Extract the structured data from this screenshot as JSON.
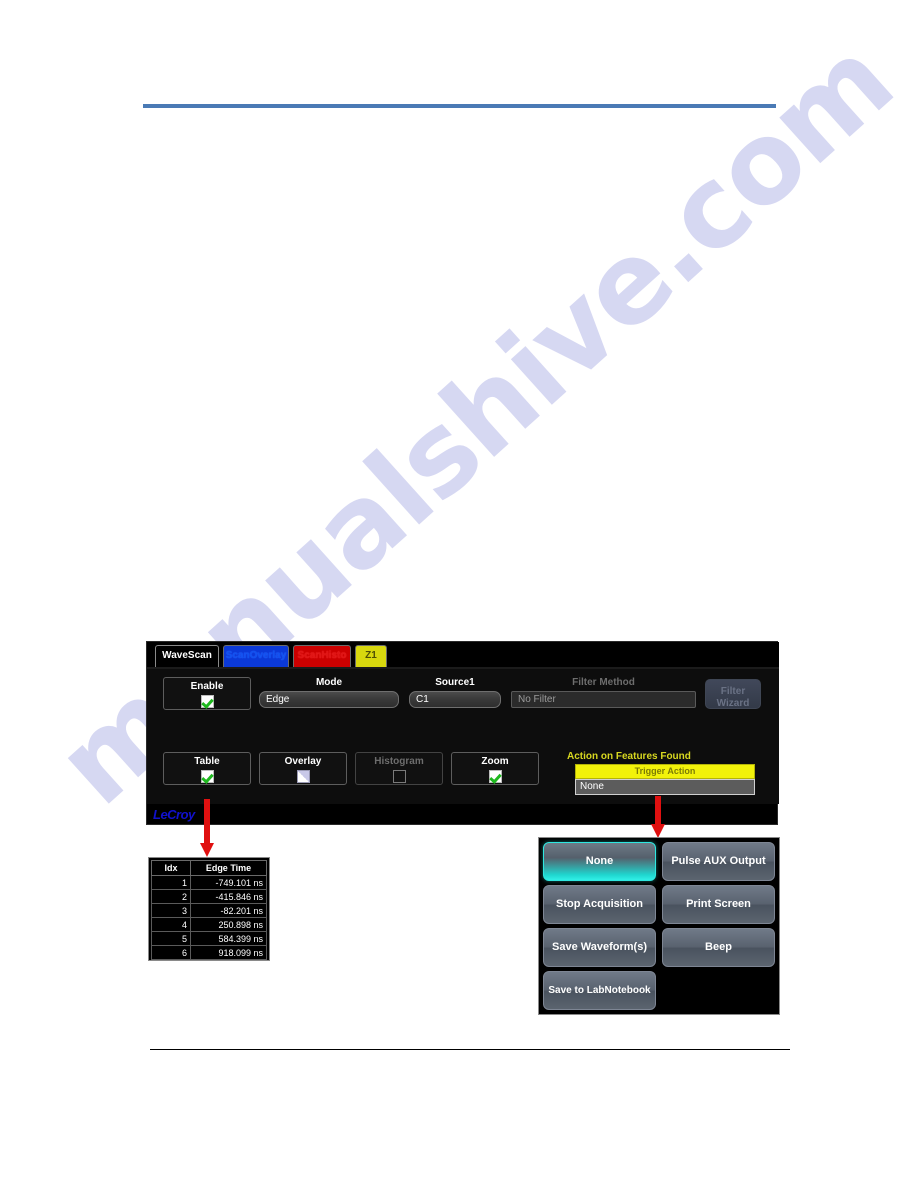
{
  "document": {
    "watermark_text": "manualshive.com"
  },
  "wavescan": {
    "tabs": [
      {
        "label": "WaveScan",
        "color": "#000000",
        "active": true
      },
      {
        "label": "ScanOverlay",
        "color": "#0b39d8",
        "active": false
      },
      {
        "label": "ScanHisto",
        "color": "#cc0000",
        "active": false
      },
      {
        "label": "Z1",
        "color": "#d8d80e",
        "active": false
      }
    ],
    "top_row": {
      "enable": {
        "label": "Enable",
        "checked": true
      },
      "mode": {
        "label": "Mode",
        "value": "Edge"
      },
      "source1": {
        "label": "Source1",
        "value": "C1"
      },
      "filter_method": {
        "label": "Filter Method",
        "value": "No Filter",
        "enabled": false
      },
      "filter_wizard": {
        "line1": "Filter",
        "line2": "Wizard",
        "enabled": false
      }
    },
    "bottom_row": {
      "table": {
        "label": "Table",
        "checked": true
      },
      "overlay": {
        "label": "Overlay",
        "checked": false
      },
      "histogram": {
        "label": "Histogram",
        "checked": false,
        "enabled": false
      },
      "zoom": {
        "label": "Zoom",
        "checked": true
      }
    },
    "action_on_features": {
      "label": "Action on Features Found",
      "header": "Trigger Action",
      "value": "None"
    },
    "logo": "LeCroy"
  },
  "edge_table": {
    "columns": [
      "Idx",
      "Edge Time"
    ],
    "rows": [
      {
        "idx": "1",
        "edge_time": "-749.101 ns"
      },
      {
        "idx": "2",
        "edge_time": "-415.846 ns"
      },
      {
        "idx": "3",
        "edge_time": "-82.201 ns"
      },
      {
        "idx": "4",
        "edge_time": "250.898 ns"
      },
      {
        "idx": "5",
        "edge_time": "584.399 ns"
      },
      {
        "idx": "6",
        "edge_time": "918.099 ns"
      }
    ]
  },
  "trigger_actions": {
    "buttons": [
      {
        "label": "None",
        "selected": true
      },
      {
        "label": "Pulse AUX Output",
        "selected": false
      },
      {
        "label": "Stop Acquisition",
        "selected": false
      },
      {
        "label": "Print Screen",
        "selected": false
      },
      {
        "label": "Save Waveform(s)",
        "selected": false
      },
      {
        "label": "Beep",
        "selected": false
      },
      {
        "label": "Save to LabNotebook",
        "selected": false
      }
    ]
  },
  "colors": {
    "rule_blue": "#4a7ab5",
    "arrow_red": "#e01010",
    "accent_cyan": "#2ee8e0",
    "accent_yellow": "#f2f20a",
    "check_green": "#1fb81f"
  }
}
